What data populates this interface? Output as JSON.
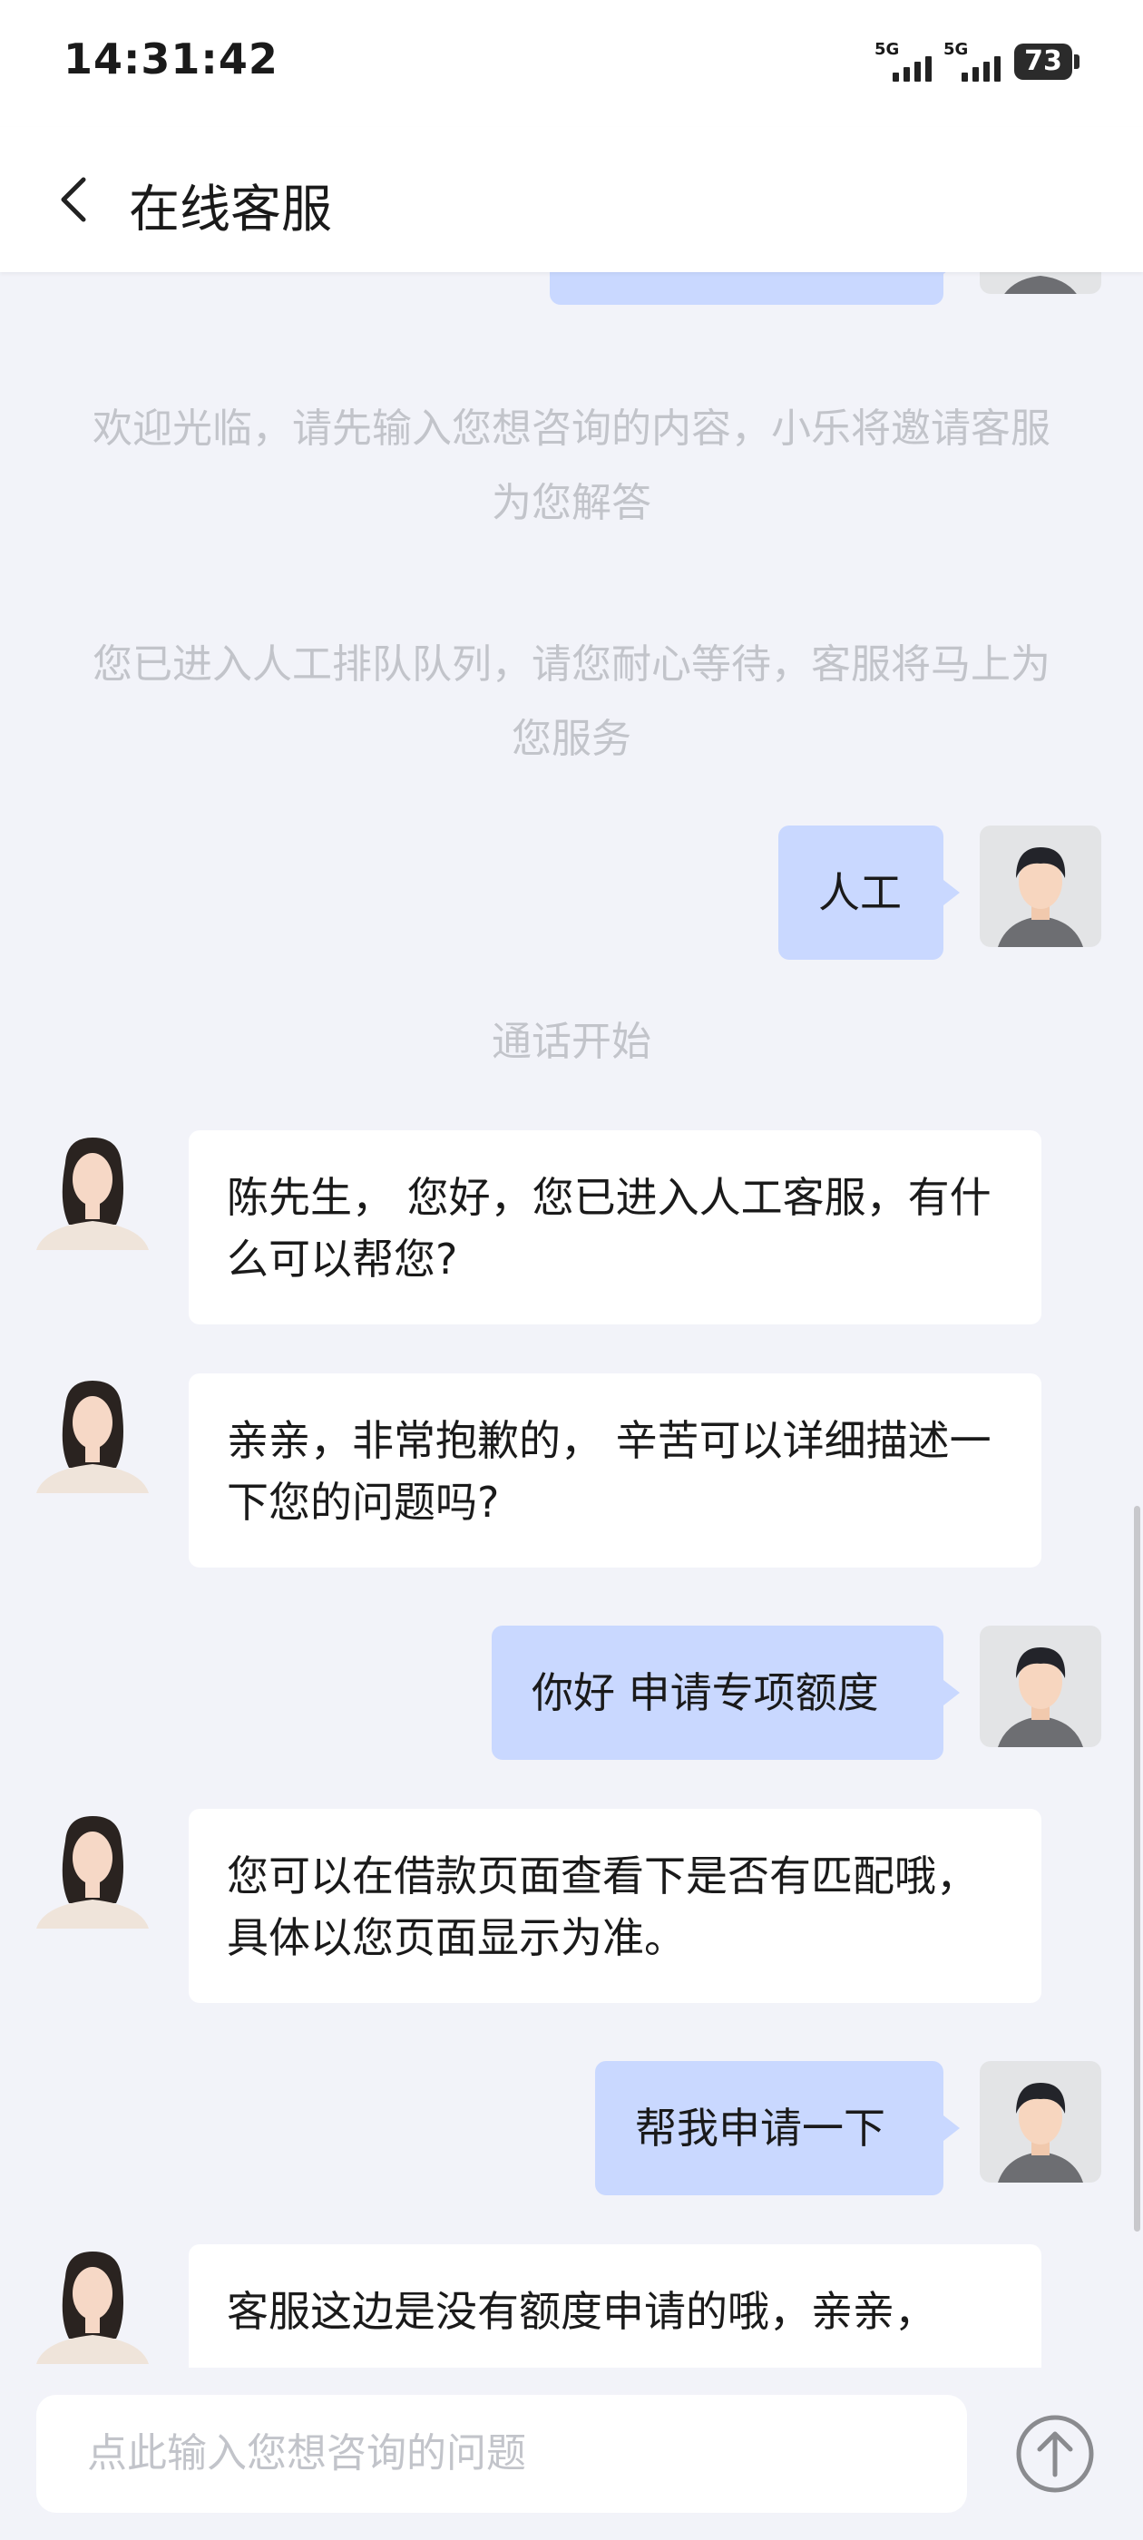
{
  "status_bar": {
    "time": "14:31:42",
    "signal1_label": "5G",
    "signal2_label": "5G",
    "battery": "73"
  },
  "header": {
    "title": "在线客服"
  },
  "messages": {
    "system1": "欢迎光临，请先输入您想咨询的内容，小乐将邀请客服为您解答",
    "system2": "您已进入人工排队队列，请您耐心等待，客服将马上为您服务",
    "user1": "人工",
    "call_start": "通话开始",
    "agent1": "陈先生， 您好，您已进入人工客服，有什么可以帮您?",
    "agent2": "亲亲，非常抱歉的， 辛苦可以详细描述一下您的问题吗?",
    "user2": "你好 申请专项额度",
    "agent3": "您可以在借款页面查看下是否有匹配哦，具体以您页面显示为准。",
    "user3": "帮我申请一下",
    "agent4": "客服这边是没有额度申请的哦，亲亲，"
  },
  "input": {
    "placeholder": "点此输入您想咨询的问题"
  },
  "colors": {
    "user_bubble": "#C9D8FF",
    "agent_bubble": "#FFFFFF",
    "background": "#F2F3F9",
    "system_text": "#C2C4CA"
  }
}
